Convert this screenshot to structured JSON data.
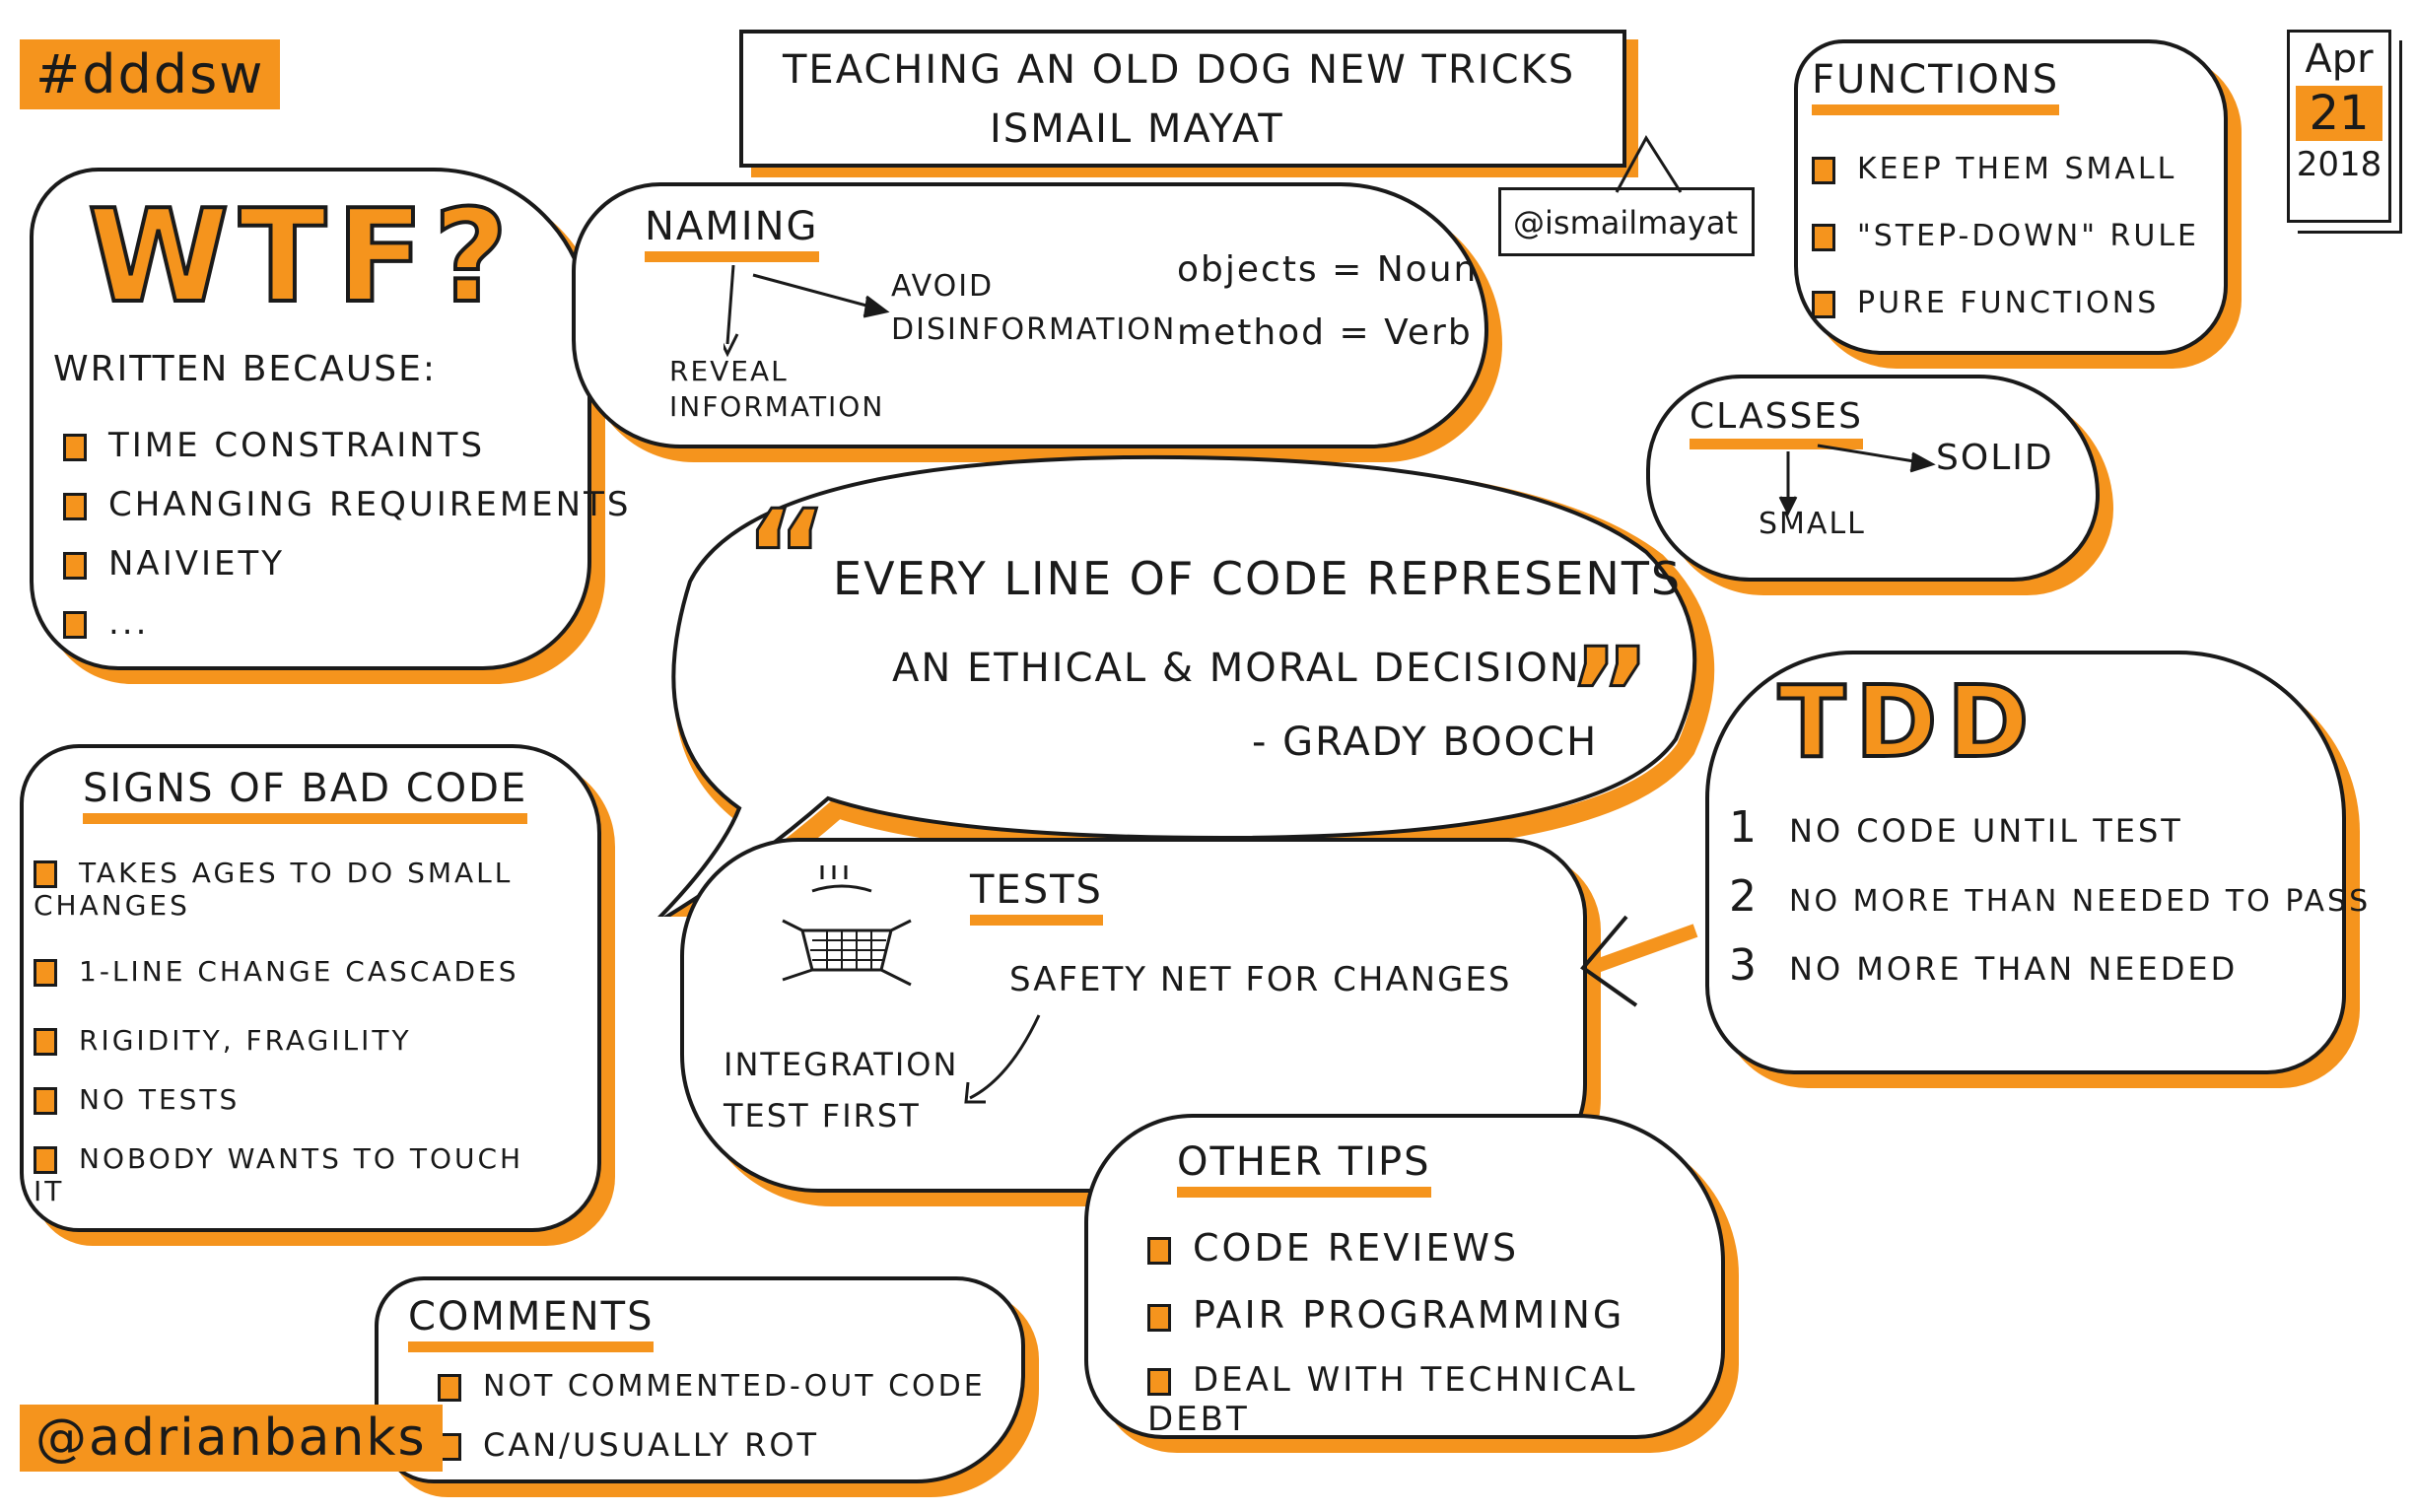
{
  "hashtag": "#dddsw",
  "author_handle": "@adrianbanks",
  "title": {
    "line1": "Teaching an old dog new tricks",
    "line2": "Ismail Mayat",
    "speaker_handle": "@ismailmayat"
  },
  "date": {
    "month": "Apr",
    "day": "21",
    "year": "2018"
  },
  "wtf": {
    "heading": "WTF?",
    "subheading": "Written because:",
    "items": [
      "Time constraints",
      "Changing requirements",
      "Naiviety",
      "..."
    ]
  },
  "naming": {
    "heading": "Naming",
    "avoid": "Avoid disinformation",
    "reveal": "Reveal information",
    "objects": "objects = Noun",
    "method": "method = Verb"
  },
  "functions": {
    "heading": "Functions",
    "items": [
      "Keep them small",
      "\"Step-down\" rule",
      "Pure functions"
    ]
  },
  "classes": {
    "heading": "Classes",
    "solid": "SOLID",
    "small": "Small"
  },
  "quote": {
    "open_mark": "“",
    "line1": "Every line of code represents",
    "line2": "an ethical & moral decision",
    "close_mark": "”",
    "attribution": "- Grady Booch"
  },
  "tdd": {
    "heading": "TDD",
    "items": [
      {
        "n": "1",
        "text": "No code until test"
      },
      {
        "n": "2",
        "text": "No more than needed to pass"
      },
      {
        "n": "3",
        "text": "No more than needed"
      }
    ]
  },
  "signs": {
    "heading": "Signs of bad code",
    "items": [
      "Takes ages to do small changes",
      "1-line change cascades",
      "Rigidity, fragility",
      "No tests",
      "Nobody wants to touch it"
    ]
  },
  "tests": {
    "heading": "Tests",
    "safety": "Safety net for changes",
    "integration": "Integration test first"
  },
  "other_tips": {
    "heading": "Other tips",
    "items": [
      "Code reviews",
      "Pair programming",
      "Deal with technical debt"
    ]
  },
  "comments": {
    "heading": "Comments",
    "items": [
      "Not commented-out code",
      "Can/usually rot"
    ]
  },
  "colors": {
    "accent": "#f5941d",
    "ink": "#1a1a1a"
  }
}
